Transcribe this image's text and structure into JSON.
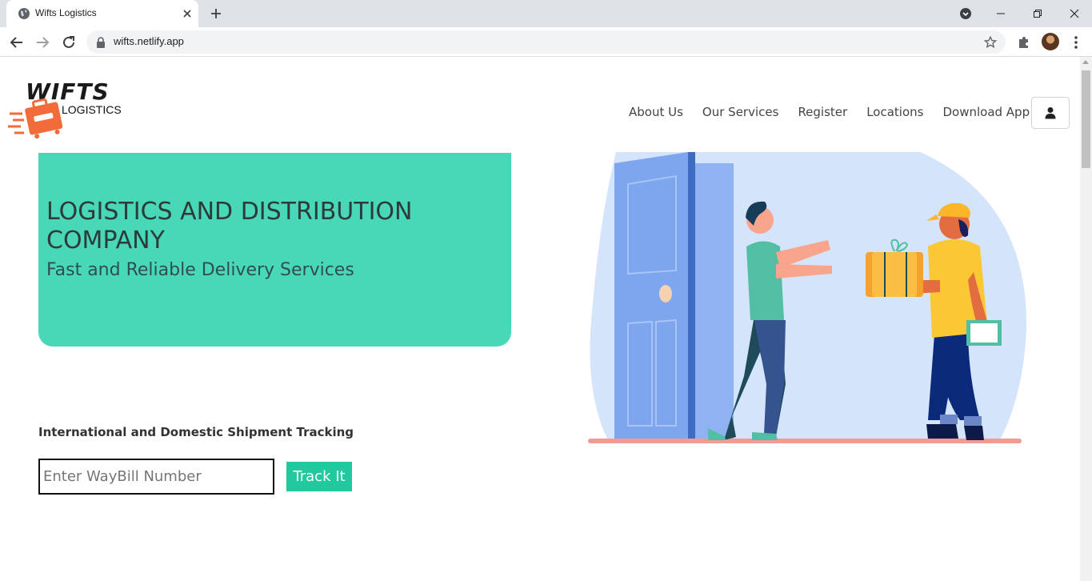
{
  "browser": {
    "tab_title": "Wifts Logistics",
    "url": "wifts.netlify.app",
    "icons": {
      "favicon": "globe-icon",
      "close": "close-icon",
      "new_tab": "plus-icon",
      "back": "back-arrow-icon",
      "forward": "forward-arrow-icon",
      "reload": "reload-icon",
      "lock": "lock-icon",
      "bookmark": "star-icon",
      "extensions": "puzzle-icon",
      "menu": "kebab-menu-icon"
    }
  },
  "header": {
    "logo": {
      "wordmark": "WIFTS",
      "tagline": "LOGISTICS"
    },
    "nav": [
      {
        "label": "About Us"
      },
      {
        "label": "Our Services"
      },
      {
        "label": "Register"
      },
      {
        "label": "Locations"
      },
      {
        "label": "Download App"
      }
    ],
    "user_icon": "user-icon"
  },
  "hero": {
    "title": "LOGISTICS AND DISTRIBUTION COMPANY",
    "subtitle": "Fast and Reliable Delivery Services"
  },
  "tracking": {
    "label": "International and Domestic Shipment Tracking",
    "input_placeholder": "Enter WayBill Number",
    "input_value": "",
    "button_label": "Track It"
  },
  "colors": {
    "hero_bg": "#48d8b7",
    "button_bg": "#22c99e",
    "brand_orange": "#f26b3a",
    "illustration_blob": "#d3e4fb"
  }
}
